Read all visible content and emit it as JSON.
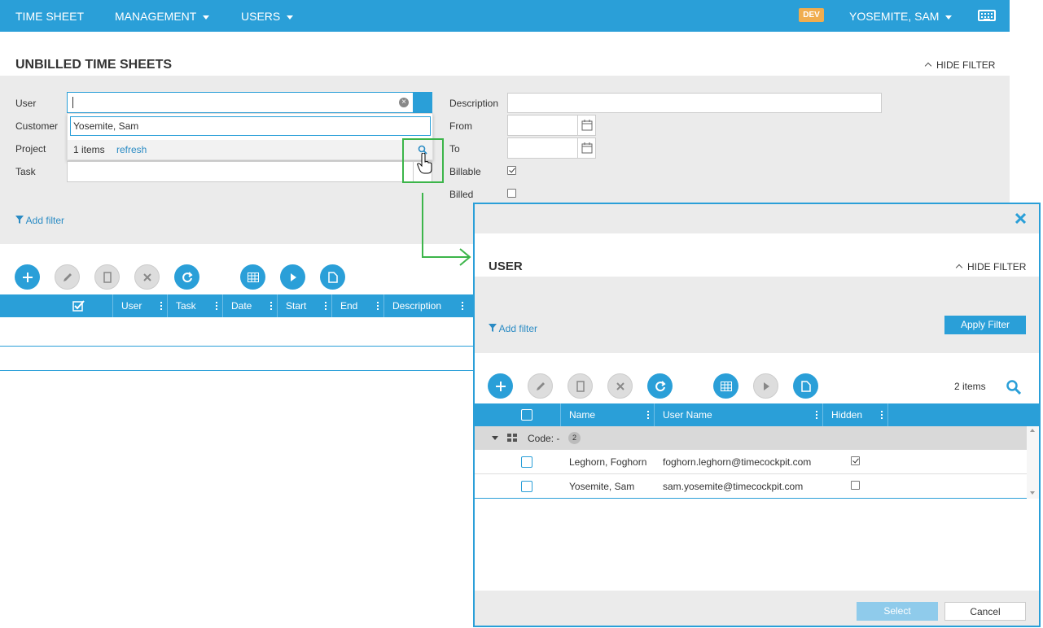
{
  "nav": {
    "timesheet": "TIME SHEET",
    "management": "MANAGEMENT",
    "users": "USERS",
    "env": "DEV",
    "user": "YOSEMITE, SAM"
  },
  "page": {
    "title": "UNBILLED TIME SHEETS",
    "hide_filter": "HIDE FILTER",
    "add_filter": "Add filter"
  },
  "filters": {
    "user": "User",
    "customer": "Customer",
    "project": "Project",
    "task": "Task",
    "description": "Description",
    "from": "From",
    "to": "To",
    "billable": "Billable",
    "billed": "Billed",
    "billable_checked": true,
    "billed_checked": false
  },
  "dropdown": {
    "option": "Yosemite, Sam",
    "count": "1 items",
    "refresh": "refresh"
  },
  "grid": {
    "columns": [
      "User",
      "Task",
      "Date",
      "Start",
      "End",
      "Description"
    ]
  },
  "dialog": {
    "title": "USER",
    "hide_filter": "HIDE FILTER",
    "add_filter": "Add filter",
    "apply": "Apply Filter",
    "items": "2 items",
    "columns": [
      "Name",
      "User Name",
      "Hidden"
    ],
    "group_label": "Code: -",
    "group_count": "2",
    "rows": [
      {
        "name": "Leghorn, Foghorn",
        "username": "foghorn.leghorn@timecockpit.com",
        "hidden": true
      },
      {
        "name": "Yosemite, Sam",
        "username": "sam.yosemite@timecockpit.com",
        "hidden": false
      }
    ],
    "select": "Select",
    "cancel": "Cancel"
  },
  "colors": {
    "accent": "#2a9fd8",
    "callout": "#3cb54a",
    "env_badge": "#f0ad4e"
  }
}
